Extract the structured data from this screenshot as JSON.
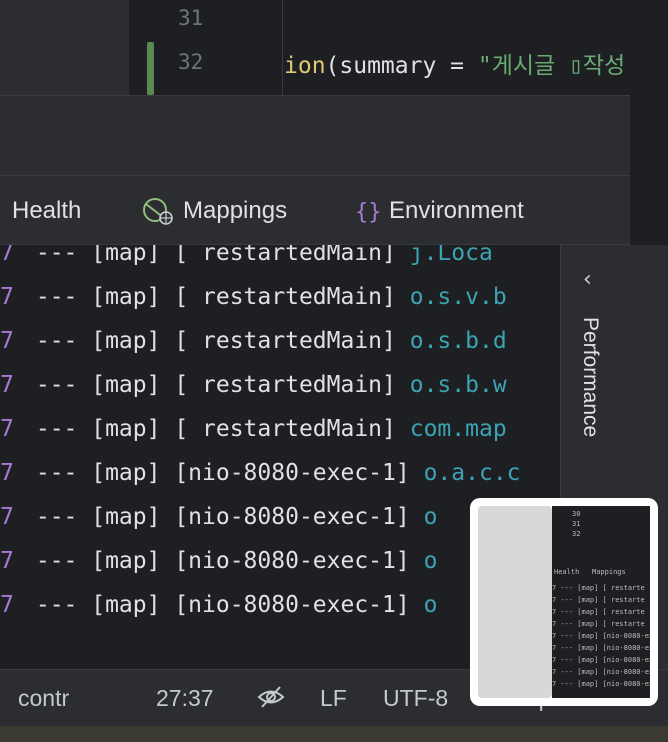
{
  "editor": {
    "line_numbers": [
      "31",
      "32"
    ],
    "code": {
      "fn": "ion",
      "args": "(summary = ",
      "string": "\"게시글 ▯작성"
    }
  },
  "tabs": [
    {
      "label": "Health"
    },
    {
      "label": "Mappings"
    },
    {
      "label": "Environment"
    }
  ],
  "log": {
    "rows": [
      {
        "pid": "7",
        "text": " --- [map] [  restartedMain] ",
        "cls": "j.Loca"
      },
      {
        "pid": "7",
        "text": " --- [map] [  restartedMain] ",
        "cls": "o.s.v.b"
      },
      {
        "pid": "7",
        "text": " --- [map] [  restartedMain] ",
        "cls": "o.s.b.d"
      },
      {
        "pid": "7",
        "text": " --- [map] [  restartedMain] ",
        "cls": "o.s.b.w"
      },
      {
        "pid": "7",
        "text": " --- [map] [  restartedMain] ",
        "cls": "com.map"
      },
      {
        "pid": "7",
        "text": " --- [map] [nio-8080-exec-1] ",
        "cls": "o.a.c.c"
      },
      {
        "pid": "7",
        "text": " --- [map] [nio-8080-exec-1] ",
        "cls": "o"
      },
      {
        "pid": "7",
        "text": " --- [map] [nio-8080-exec-1] ",
        "cls": "o"
      },
      {
        "pid": "7",
        "text": " --- [map] [nio-8080-exec-1] ",
        "cls": "o"
      }
    ]
  },
  "side_panel": {
    "label": "Performance",
    "chevron": "‹"
  },
  "status_bar": {
    "branch": "contr",
    "position": "27:37",
    "line_ending": "LF",
    "encoding": "UTF-8",
    "indent": "4 spaces"
  },
  "thumbnail": {
    "lines": [
      "30",
      "31",
      "32"
    ],
    "tabs": [
      "Health",
      "Mappings"
    ],
    "rows": [
      "7 --- [map] [  restarte",
      "7 --- [map] [  restarte",
      "7 --- [map] [  restarte",
      "7 --- [map] [  restarte",
      "7 --- [map] [nio-8080-ex",
      "7 --- [map] [nio-8080-ex",
      "7 --- [map] [nio-8080-ex",
      "7 --- [map] [nio-8080-ex",
      "7 --- [map] [nio-8080-ex"
    ]
  },
  "colors": {
    "background": "#1e1f22",
    "panel": "#2b2d30",
    "string": "#6aab73",
    "function": "#e2c870",
    "class_name": "#3ca3b3",
    "pid": "#a77ad6",
    "change_marker": "#5a8a52"
  },
  "icons": [
    "globe-icon",
    "braces-icon",
    "chevron-left-icon",
    "eye-off-icon"
  ]
}
